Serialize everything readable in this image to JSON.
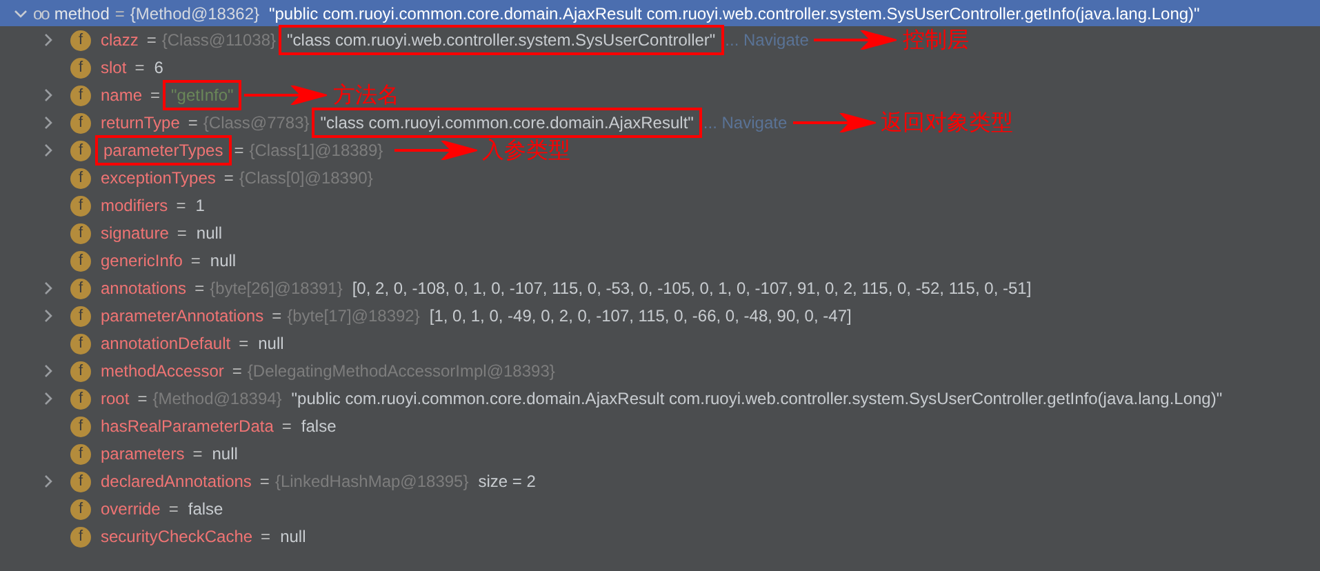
{
  "separator": "=",
  "tree": {
    "name": "method",
    "type_ref": "{Method@18362}",
    "value": "\"public com.ruoyi.common.core.domain.AjaxResult com.ruoyi.web.controller.system.SysUserController.getInfo(java.lang.Long)\"",
    "kind": "plain",
    "expanded": true,
    "selected": true,
    "icon": "oo",
    "children": [
      {
        "name": "clazz",
        "type_ref": "{Class@11038}",
        "value": "\"class com.ruoyi.web.controller.system.SysUserController\"",
        "kind": "plain",
        "expanded": false,
        "icon": "f",
        "value_boxed": true,
        "navigate": "... Navigate",
        "note": "控制层"
      },
      {
        "name": "slot",
        "value": "6",
        "kind": "plain",
        "icon": "f"
      },
      {
        "name": "name",
        "value": "\"getInfo\"",
        "kind": "string",
        "expanded": false,
        "icon": "f",
        "value_boxed": true,
        "note": "方法名"
      },
      {
        "name": "returnType",
        "type_ref": "{Class@7783}",
        "value": "\"class com.ruoyi.common.core.domain.AjaxResult\"",
        "kind": "plain",
        "expanded": false,
        "icon": "f",
        "value_boxed": true,
        "navigate": "... Navigate",
        "note": "返回对象类型"
      },
      {
        "name": "parameterTypes",
        "type_ref": "{Class[1]@18389}",
        "expanded": false,
        "icon": "f",
        "name_boxed": true,
        "note": "入参类型"
      },
      {
        "name": "exceptionTypes",
        "type_ref": "{Class[0]@18390}",
        "icon": "f"
      },
      {
        "name": "modifiers",
        "value": "1",
        "kind": "plain",
        "icon": "f"
      },
      {
        "name": "signature",
        "value": "null",
        "kind": "plain",
        "icon": "f"
      },
      {
        "name": "genericInfo",
        "value": "null",
        "kind": "plain",
        "icon": "f"
      },
      {
        "name": "annotations",
        "type_ref": "{byte[26]@18391}",
        "value": "[0, 2, 0, -108, 0, 1, 0, -107, 115, 0, -53, 0, -105, 0, 1, 0, -107, 91, 0, 2, 115, 0, -52, 115, 0, -51]",
        "kind": "plain",
        "expanded": false,
        "icon": "f"
      },
      {
        "name": "parameterAnnotations",
        "type_ref": "{byte[17]@18392}",
        "value": "[1, 0, 1, 0, -49, 0, 2, 0, -107, 115, 0, -66, 0, -48, 90, 0, -47]",
        "kind": "plain",
        "expanded": false,
        "icon": "f"
      },
      {
        "name": "annotationDefault",
        "value": "null",
        "kind": "plain",
        "icon": "f"
      },
      {
        "name": "methodAccessor",
        "type_ref": "{DelegatingMethodAccessorImpl@18393}",
        "expanded": false,
        "icon": "f"
      },
      {
        "name": "root",
        "type_ref": "{Method@18394}",
        "value": "\"public com.ruoyi.common.core.domain.AjaxResult com.ruoyi.web.controller.system.SysUserController.getInfo(java.lang.Long)\"",
        "kind": "plain",
        "expanded": false,
        "icon": "f"
      },
      {
        "name": "hasRealParameterData",
        "value": "false",
        "kind": "plain",
        "icon": "f"
      },
      {
        "name": "parameters",
        "value": "null",
        "kind": "plain",
        "icon": "f"
      },
      {
        "name": "declaredAnnotations",
        "type_ref": "{LinkedHashMap@18395}",
        "value": " size = 2",
        "kind": "plain",
        "expanded": false,
        "icon": "f"
      },
      {
        "name": "override",
        "value": "false",
        "kind": "plain",
        "icon": "f"
      },
      {
        "name": "securityCheckCache",
        "value": "null",
        "kind": "plain",
        "icon": "f"
      }
    ]
  }
}
